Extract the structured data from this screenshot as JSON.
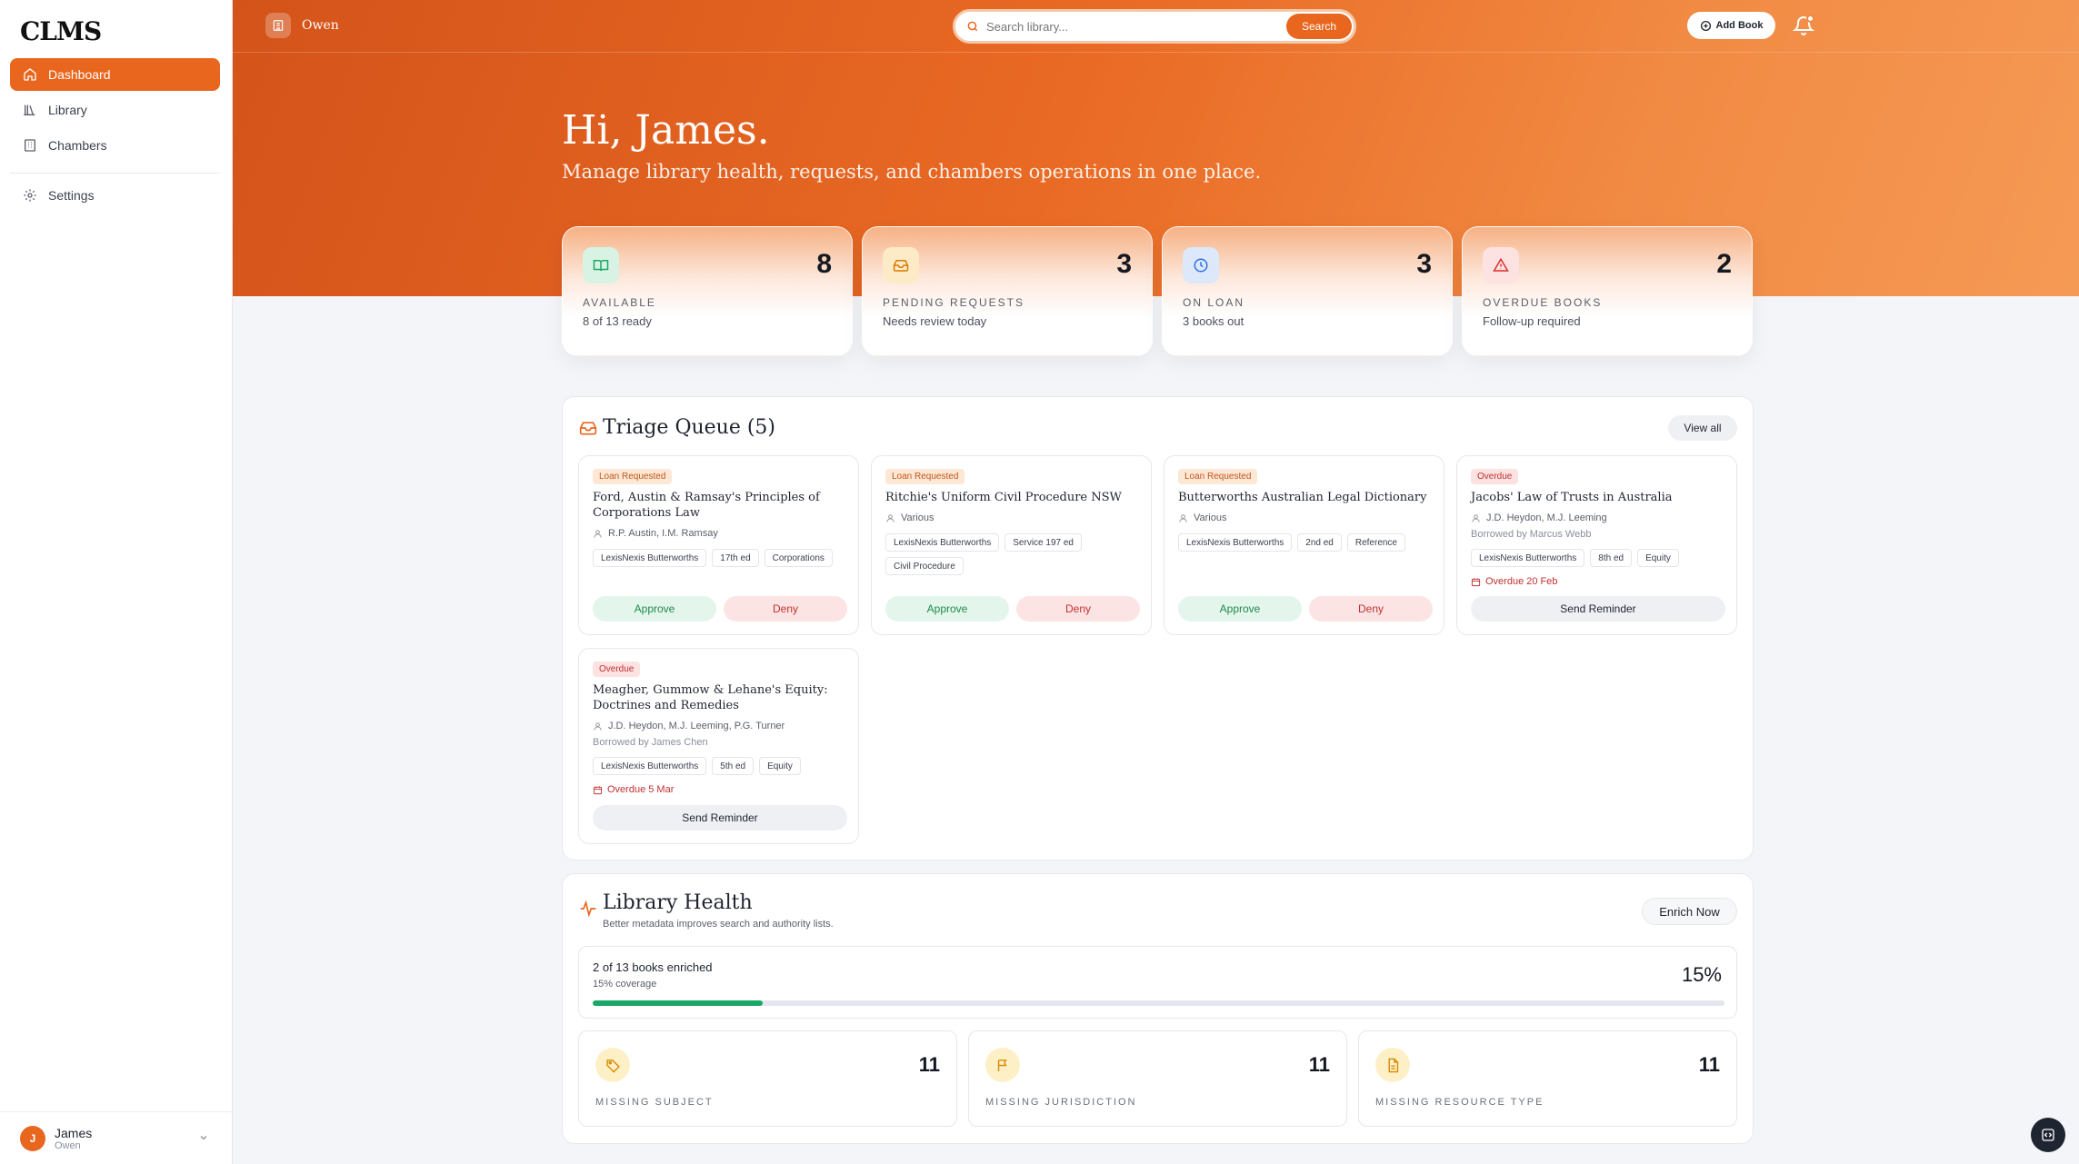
{
  "sidebar": {
    "logo": "CLMS",
    "items": [
      {
        "label": "Dashboard"
      },
      {
        "label": "Library"
      },
      {
        "label": "Chambers"
      },
      {
        "label": "Settings"
      }
    ],
    "user": {
      "initial": "J",
      "name": "James",
      "org": "Owen"
    }
  },
  "topbar": {
    "org": "Owen",
    "search_placeholder": "Search library...",
    "search_label": "Search",
    "add_book_label": "Add Book"
  },
  "hero": {
    "greeting": "Hi, James.",
    "subtitle": "Manage library health, requests, and chambers operations in one place."
  },
  "stats": [
    {
      "label": "AVAILABLE",
      "value": "8",
      "sub": "8 of 13 ready",
      "icon": "book-open-icon",
      "color": "#1aa866"
    },
    {
      "label": "PENDING REQUESTS",
      "value": "3",
      "sub": "Needs review today",
      "icon": "inbox-icon",
      "color": "#d97a00"
    },
    {
      "label": "ON LOAN",
      "value": "3",
      "sub": "3 books out",
      "icon": "clock-icon",
      "color": "#2f6fe0"
    },
    {
      "label": "OVERDUE BOOKS",
      "value": "2",
      "sub": "Follow-up required",
      "icon": "alert-triangle-icon",
      "color": "#d93030"
    }
  ],
  "triage": {
    "title": "Triage Queue (5)",
    "view_all": "View all",
    "approve_label": "Approve",
    "deny_label": "Deny",
    "remind_label": "Send Reminder",
    "cards": [
      {
        "status": "Loan Requested",
        "title": "Ford, Austin & Ramsay's Principles of Corporations Law",
        "authors": "R.P. Austin, I.M. Ramsay",
        "tags": [
          "LexisNexis Butterworths",
          "17th ed",
          "Corporations"
        ]
      },
      {
        "status": "Loan Requested",
        "title": "Ritchie's Uniform Civil Procedure NSW",
        "authors": "Various",
        "tags": [
          "LexisNexis Butterworths",
          "Service 197 ed",
          "Civil Procedure"
        ]
      },
      {
        "status": "Loan Requested",
        "title": "Butterworths Australian Legal Dictionary",
        "authors": "Various",
        "tags": [
          "LexisNexis Butterworths",
          "2nd ed",
          "Reference"
        ]
      },
      {
        "status": "Overdue",
        "title": "Jacobs' Law of Trusts in Australia",
        "authors": "J.D. Heydon, M.J. Leeming",
        "borrowed": "Borrowed by Marcus Webb",
        "tags": [
          "LexisNexis Butterworths",
          "8th ed",
          "Equity"
        ],
        "due": "Overdue 20 Feb"
      },
      {
        "status": "Overdue",
        "title": "Meagher, Gummow & Lehane's Equity: Doctrines and Remedies",
        "authors": "J.D. Heydon, M.J. Leeming, P.G. Turner",
        "borrowed": "Borrowed by James Chen",
        "tags": [
          "LexisNexis Butterworths",
          "5th ed",
          "Equity"
        ],
        "due": "Overdue 5 Mar"
      }
    ]
  },
  "health": {
    "title": "Library Health",
    "subtitle": "Better metadata improves search and authority lists.",
    "enrich_label": "Enrich Now",
    "coverage_title": "2 of 13 books enriched",
    "coverage_sub": "15% coverage",
    "coverage_pct": "15%",
    "coverage_fraction": 0.15,
    "metrics": [
      {
        "label": "MISSING SUBJECT",
        "value": "11",
        "icon": "tag-icon"
      },
      {
        "label": "MISSING JURISDICTION",
        "value": "11",
        "icon": "flag-icon"
      },
      {
        "label": "MISSING RESOURCE TYPE",
        "value": "11",
        "icon": "file-text-icon"
      }
    ]
  },
  "colors": {
    "accent": "#e8661e",
    "success": "#1aa866",
    "danger": "#c23030"
  }
}
